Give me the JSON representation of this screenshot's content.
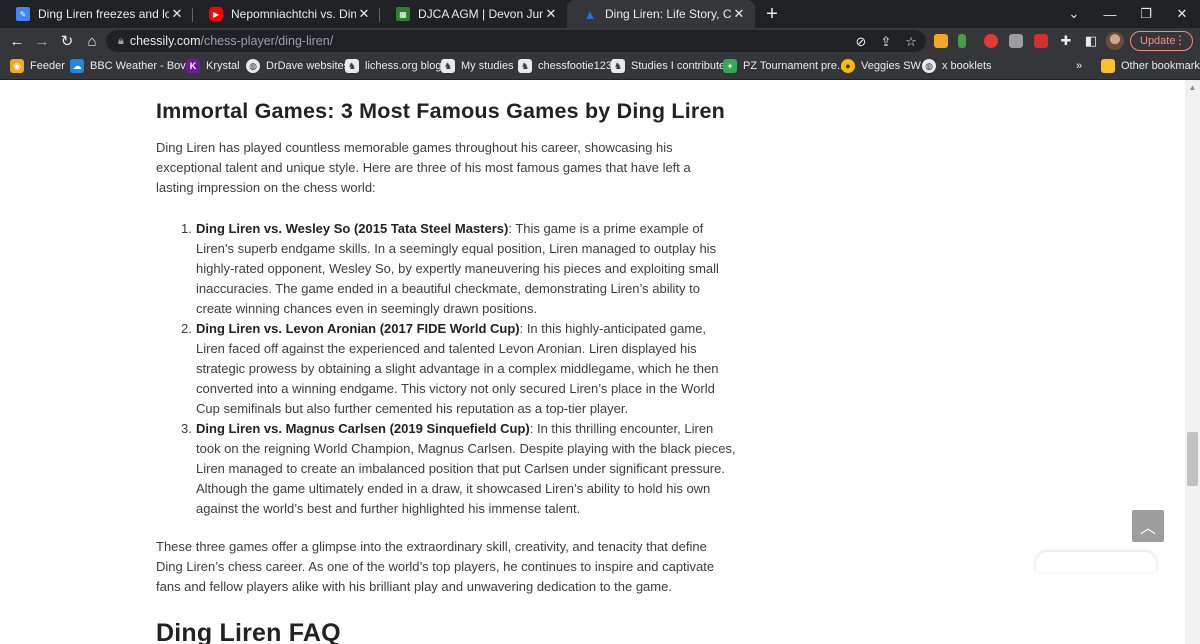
{
  "tabs": [
    {
      "title": "Ding Liren freezes and loses hea",
      "favicon_color": "#4285f4",
      "active": false
    },
    {
      "title": "Nepomniachtchi vs. Ding | FIDE V",
      "favicon_color": "#ff0000",
      "active": false
    },
    {
      "title": "DJCA AGM | Devon Junior Chess",
      "favicon_color": "#2e7d32",
      "active": false
    },
    {
      "title": "Ding Liren: Life Story, Chess Ach",
      "favicon_color": "#1a73e8",
      "active": true
    }
  ],
  "toolbar": {
    "url_domain": "chessily.com",
    "url_path": "/chess-player/ding-liren/",
    "update_label": "Update"
  },
  "bookmarks": [
    {
      "label": "Feeder",
      "icon": "rss-icon",
      "color": "#f5a623"
    },
    {
      "label": "BBC Weather - Bov...",
      "icon": "weather-icon",
      "color": "#1e88e5"
    },
    {
      "label": "Krystal",
      "icon": "krystal-icon",
      "color": "#6a1b9a"
    },
    {
      "label": "DrDave websites",
      "icon": "globe-icon",
      "color": "#e8eaed"
    },
    {
      "label": "lichess.org blog",
      "icon": "lichess-icon",
      "color": "#e8eaed"
    },
    {
      "label": "My studies",
      "icon": "lichess-icon",
      "color": "#e8eaed"
    },
    {
      "label": "chessfootie123",
      "icon": "lichess-icon",
      "color": "#e8eaed"
    },
    {
      "label": "Studies I contribute",
      "icon": "lichess-icon",
      "color": "#e8eaed"
    },
    {
      "label": "PZ Tournament pre...",
      "icon": "plus-icon",
      "color": "#34a853"
    },
    {
      "label": "Veggies SW",
      "icon": "veggies-icon",
      "color": "#fbbc04"
    },
    {
      "label": "x booklets",
      "icon": "globe-icon",
      "color": "#e8eaed"
    }
  ],
  "other_bookmarks": "Other bookmarks",
  "article": {
    "heading": "Immortal Games: 3 Most Famous Games by Ding Liren",
    "intro": "Ding Liren has played countless memorable games throughout his career, showcasing his exceptional talent and unique style. Here are three of his most famous games that have left a lasting impression on the chess world:",
    "games": [
      {
        "num": "1.",
        "title": "Ding Liren vs. Wesley So (2015 Tata Steel Masters)",
        "text": ": This game is a prime example of Liren’s superb endgame skills. In a seemingly equal position, Liren managed to outplay his highly-rated opponent, Wesley So, by expertly maneuvering his pieces and exploiting small inaccuracies. The game ended in a beautiful checkmate, demonstrating Liren’s ability to create winning chances even in seemingly drawn positions."
      },
      {
        "num": "2.",
        "title": "Ding Liren vs. Levon Aronian (2017 FIDE World Cup)",
        "text": ": In this highly-anticipated game, Liren faced off against the experienced and talented Levon Aronian. Liren displayed his strategic prowess by obtaining a slight advantage in a complex middlegame, which he then converted into a winning endgame. This victory not only secured Liren’s place in the World Cup semifinals but also further cemented his reputation as a top-tier player."
      },
      {
        "num": "3.",
        "title": "Ding Liren vs. Magnus Carlsen (2019 Sinquefield Cup)",
        "text": ": In this thrilling encounter, Liren took on the reigning World Champion, Magnus Carlsen. Despite playing with the black pieces, Liren managed to create an imbalanced position that put Carlsen under significant pressure. Although the game ultimately ended in a draw, it showcased Liren’s ability to hold his own against the world’s best and further highlighted his immense talent."
      }
    ],
    "outro": "These three games offer a glimpse into the extraordinary skill, creativity, and tenacity that define Ding Liren’s chess career. As one of the world’s top players, he continues to inspire and captivate fans and fellow players alike with his brilliant play and unwavering dedication to the game.",
    "faq_heading": "Ding Liren FAQ"
  }
}
